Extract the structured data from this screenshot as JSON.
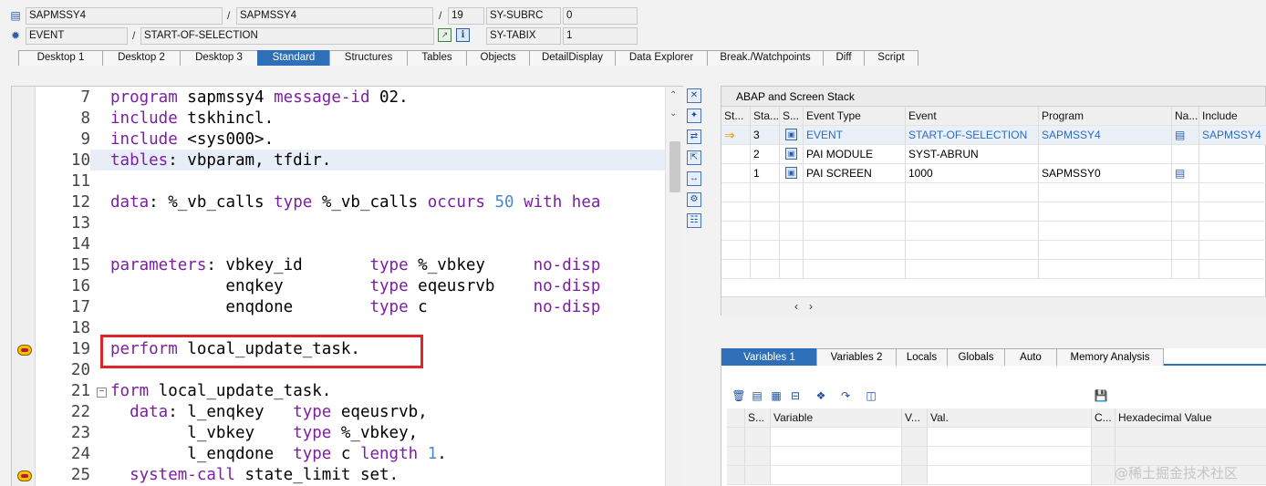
{
  "header": {
    "row1": {
      "program1": "SAPMSSY4",
      "program2": "SAPMSSY4",
      "line": "19",
      "var_name": "SY-SUBRC",
      "var_value": "0"
    },
    "row2": {
      "event_type": "EVENT",
      "event": "START-OF-SELECTION",
      "var_name": "SY-TABIX",
      "var_value": "1"
    },
    "separator": "/"
  },
  "tabs": [
    "Desktop 1",
    "Desktop 2",
    "Desktop 3",
    "Standard",
    "Structures",
    "Tables",
    "Objects",
    "DetailDisplay",
    "Data Explorer",
    "Break./Watchpoints",
    "Diff",
    "Script"
  ],
  "active_tab": "Standard",
  "editor": {
    "lines": [
      {
        "no": "7",
        "code": [
          [
            "kw",
            "program"
          ],
          [
            "t",
            " sapmssy4 "
          ],
          [
            "kw",
            "message-id"
          ],
          [
            "t",
            " 02."
          ]
        ]
      },
      {
        "no": "8",
        "code": [
          [
            "kw",
            "include"
          ],
          [
            "t",
            " tskhincl."
          ]
        ]
      },
      {
        "no": "9",
        "code": [
          [
            "kw",
            "include"
          ],
          [
            "t",
            " <sys000>."
          ]
        ]
      },
      {
        "no": "10",
        "code": [
          [
            "kw",
            "tables"
          ],
          [
            "t",
            ": vbparam, tfdir."
          ]
        ]
      },
      {
        "no": "11",
        "code": []
      },
      {
        "no": "12",
        "code": [
          [
            "kw",
            "data"
          ],
          [
            "t",
            ": %_vb_calls "
          ],
          [
            "kw",
            "type"
          ],
          [
            "t",
            " %_vb_calls "
          ],
          [
            "kw",
            "occurs"
          ],
          [
            "t",
            " "
          ],
          [
            "num",
            "50"
          ],
          [
            "t",
            " "
          ],
          [
            "kw",
            "with hea"
          ]
        ]
      },
      {
        "no": "13",
        "code": []
      },
      {
        "no": "14",
        "code": []
      },
      {
        "no": "15",
        "code": [
          [
            "kw",
            "parameters"
          ],
          [
            "t",
            ": vbkey_id       "
          ],
          [
            "kw",
            "type"
          ],
          [
            "t",
            " %_vbkey     "
          ],
          [
            "kw",
            "no-disp"
          ]
        ]
      },
      {
        "no": "16",
        "code": [
          [
            "t",
            "            enqkey         "
          ],
          [
            "kw",
            "type"
          ],
          [
            "t",
            " eqeusrvb    "
          ],
          [
            "kw",
            "no-disp"
          ]
        ]
      },
      {
        "no": "17",
        "code": [
          [
            "t",
            "            enqdone        "
          ],
          [
            "kw",
            "type"
          ],
          [
            "t",
            " c           "
          ],
          [
            "kw",
            "no-disp"
          ]
        ]
      },
      {
        "no": "18",
        "code": []
      },
      {
        "no": "19",
        "code": [
          [
            "kw",
            "perform"
          ],
          [
            "t",
            " local_update_task."
          ]
        ]
      },
      {
        "no": "20",
        "code": []
      },
      {
        "no": "21",
        "code": [
          [
            "kw",
            "form"
          ],
          [
            "t",
            " local_update_task."
          ]
        ]
      },
      {
        "no": "22",
        "code": [
          [
            "t",
            "  "
          ],
          [
            "kw",
            "data"
          ],
          [
            "t",
            ": l_enqkey   "
          ],
          [
            "kw",
            "type"
          ],
          [
            "t",
            " eqeusrvb,"
          ]
        ]
      },
      {
        "no": "23",
        "code": [
          [
            "t",
            "        l_vbkey    "
          ],
          [
            "kw",
            "type"
          ],
          [
            "t",
            " %_vbkey,"
          ]
        ]
      },
      {
        "no": "24",
        "code": [
          [
            "t",
            "        l_enqdone  "
          ],
          [
            "kw",
            "type"
          ],
          [
            "t",
            " c "
          ],
          [
            "kw",
            "length"
          ],
          [
            "t",
            " "
          ],
          [
            "num",
            "1"
          ],
          [
            "t",
            "."
          ]
        ]
      },
      {
        "no": "25",
        "code": [
          [
            "t",
            "  "
          ],
          [
            "kw",
            "system-call"
          ],
          [
            "t",
            " state_limit set."
          ]
        ]
      }
    ]
  },
  "stack": {
    "title": "ABAP and Screen Stack",
    "columns": [
      "St...",
      "Sta...",
      "S...",
      "Event Type",
      "Event",
      "Program",
      "Na...",
      "Include"
    ],
    "rows": [
      {
        "level": "3",
        "event_type": "EVENT",
        "event": "START-OF-SELECTION",
        "program": "SAPMSSY4",
        "include": "SAPMSSY4"
      },
      {
        "level": "2",
        "event_type": "PAI MODULE",
        "event": "SYST-ABRUN",
        "program": "",
        "include": ""
      },
      {
        "level": "1",
        "event_type": "PAI SCREEN",
        "event": "1000",
        "program": "SAPMSSY0",
        "include": ""
      }
    ]
  },
  "var_tabs": [
    "Variables 1",
    "Variables 2",
    "Locals",
    "Globals",
    "Auto",
    "Memory Analysis"
  ],
  "var_columns": [
    "S...",
    "Variable",
    "V...",
    "Val.",
    "C...",
    "Hexadecimal Value"
  ],
  "watermark": "@稀土掘金技术社区"
}
